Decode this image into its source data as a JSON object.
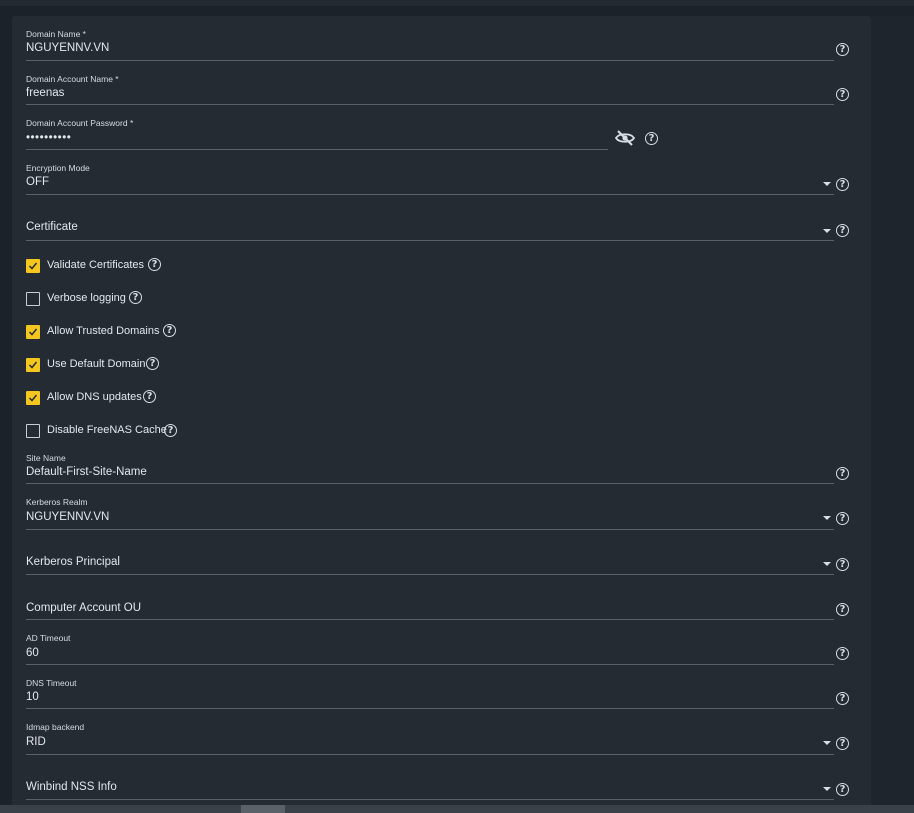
{
  "fields": {
    "domain_name": {
      "label": "Domain Name *",
      "value": "NGUYENNV.VN"
    },
    "account_name": {
      "label": "Domain Account Name *",
      "value": "freenas"
    },
    "account_password": {
      "label": "Domain Account Password *",
      "value": "••••••••••"
    },
    "encryption_mode": {
      "label": "Encryption Mode",
      "value": "OFF"
    },
    "certificate": {
      "placeholder": "Certificate"
    },
    "site_name": {
      "label": "Site Name",
      "value": "Default-First-Site-Name"
    },
    "kerberos_realm": {
      "label": "Kerberos Realm",
      "value": "NGUYENNV.VN"
    },
    "kerberos_principal": {
      "placeholder": "Kerberos Principal"
    },
    "computer_account_ou": {
      "placeholder": "Computer Account OU"
    },
    "ad_timeout": {
      "label": "AD Timeout",
      "value": "60"
    },
    "dns_timeout": {
      "label": "DNS Timeout",
      "value": "10"
    },
    "idmap_backend": {
      "label": "Idmap backend",
      "value": "RID"
    },
    "winbind_nss_info": {
      "placeholder": "Winbind NSS Info"
    }
  },
  "checkboxes": {
    "validate_certificates": {
      "label": "Validate Certificates",
      "checked": true
    },
    "verbose_logging": {
      "label": "Verbose logging",
      "checked": false
    },
    "allow_trusted_domains": {
      "label": "Allow Trusted Domains",
      "checked": true
    },
    "use_default_domain": {
      "label": "Use Default Domain",
      "checked": true
    },
    "allow_dns_updates": {
      "label": "Allow DNS updates",
      "checked": true
    },
    "disable_freenas_cache": {
      "label": "Disable FreeNAS Cache",
      "checked": false
    }
  },
  "icons": {
    "help": "help-circle-icon",
    "password_toggle": "eye-off-icon",
    "dropdown": "caret-down-icon",
    "check": "check-icon"
  },
  "colors": {
    "panel_bg": "#242b33",
    "checkbox_accent": "#f5c61d",
    "text": "#e4e8ec"
  },
  "help_glyph": "?"
}
